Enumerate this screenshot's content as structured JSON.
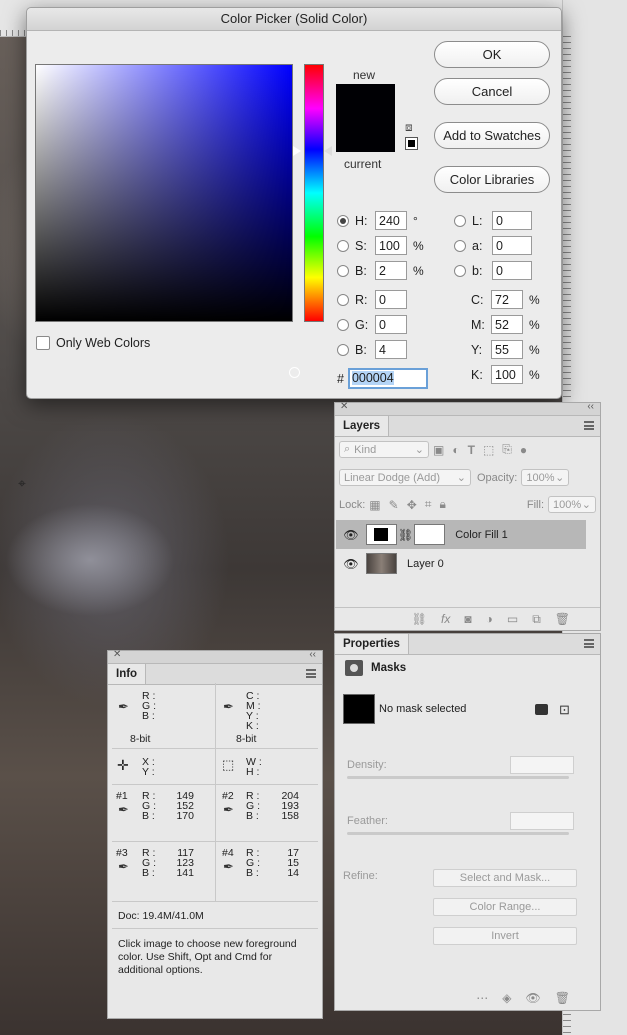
{
  "picker": {
    "title": "Color Picker (Solid Color)",
    "only_web_colors": "Only Web Colors",
    "new_label": "new",
    "current_label": "current",
    "buttons": {
      "ok": "OK",
      "cancel": "Cancel",
      "add_swatches": "Add to Swatches",
      "color_libraries": "Color Libraries"
    },
    "hsb": [
      {
        "label": "H:",
        "value": "240",
        "unit": "°",
        "selected": true
      },
      {
        "label": "S:",
        "value": "100",
        "unit": "%"
      },
      {
        "label": "B:",
        "value": "2",
        "unit": "%"
      }
    ],
    "rgb": [
      {
        "label": "R:",
        "value": "0"
      },
      {
        "label": "G:",
        "value": "0"
      },
      {
        "label": "B:",
        "value": "4"
      }
    ],
    "lab": [
      {
        "label": "L:",
        "value": "0"
      },
      {
        "label": "a:",
        "value": "0"
      },
      {
        "label": "b:",
        "value": "0"
      }
    ],
    "cmyk": [
      {
        "label": "C:",
        "value": "72",
        "unit": "%"
      },
      {
        "label": "M:",
        "value": "52",
        "unit": "%"
      },
      {
        "label": "Y:",
        "value": "55",
        "unit": "%"
      },
      {
        "label": "K:",
        "value": "100",
        "unit": "%"
      }
    ],
    "hex_prefix": "#",
    "hex": "000004",
    "color": "#000004"
  },
  "layers": {
    "tab": "Layers",
    "filter": "Kind",
    "blend_mode": "Linear Dodge (Add)",
    "opacity_label": "Opacity:",
    "opacity_value": "100%",
    "lock_label": "Lock:",
    "fill_label": "Fill:",
    "fill_value": "100%",
    "items": [
      {
        "name": "Color Fill 1",
        "selected": true
      },
      {
        "name": "Layer 0",
        "selected": false
      }
    ]
  },
  "properties": {
    "tab": "Properties",
    "section": "Masks",
    "no_mask": "No mask selected",
    "density": "Density:",
    "feather": "Feather:",
    "refine": "Refine:",
    "select_and_mask": "Select and Mask...",
    "color_range": "Color Range...",
    "invert": "Invert"
  },
  "info": {
    "tab": "Info",
    "rgb_labels": "R :\nG :\nB :",
    "cmyk_labels": "C :\nM :\nY :\nK :",
    "bit1": "8-bit",
    "bit2": "8-bit",
    "xy_labels": "X :\nY :",
    "wh_labels": "W :\nH :",
    "samples": [
      {
        "id": "#1",
        "r": "149",
        "g": "152",
        "b": "170"
      },
      {
        "id": "#2",
        "r": "204",
        "g": "193",
        "b": "158"
      },
      {
        "id": "#3",
        "r": "117",
        "g": "123",
        "b": "141"
      },
      {
        "id": "#4",
        "r": "17",
        "g": "15",
        "b": "14"
      }
    ],
    "doc": "Doc: 19.4M/41.0M",
    "hint": "Click image to choose new foreground color.  Use Shift, Opt and Cmd for additional options."
  }
}
